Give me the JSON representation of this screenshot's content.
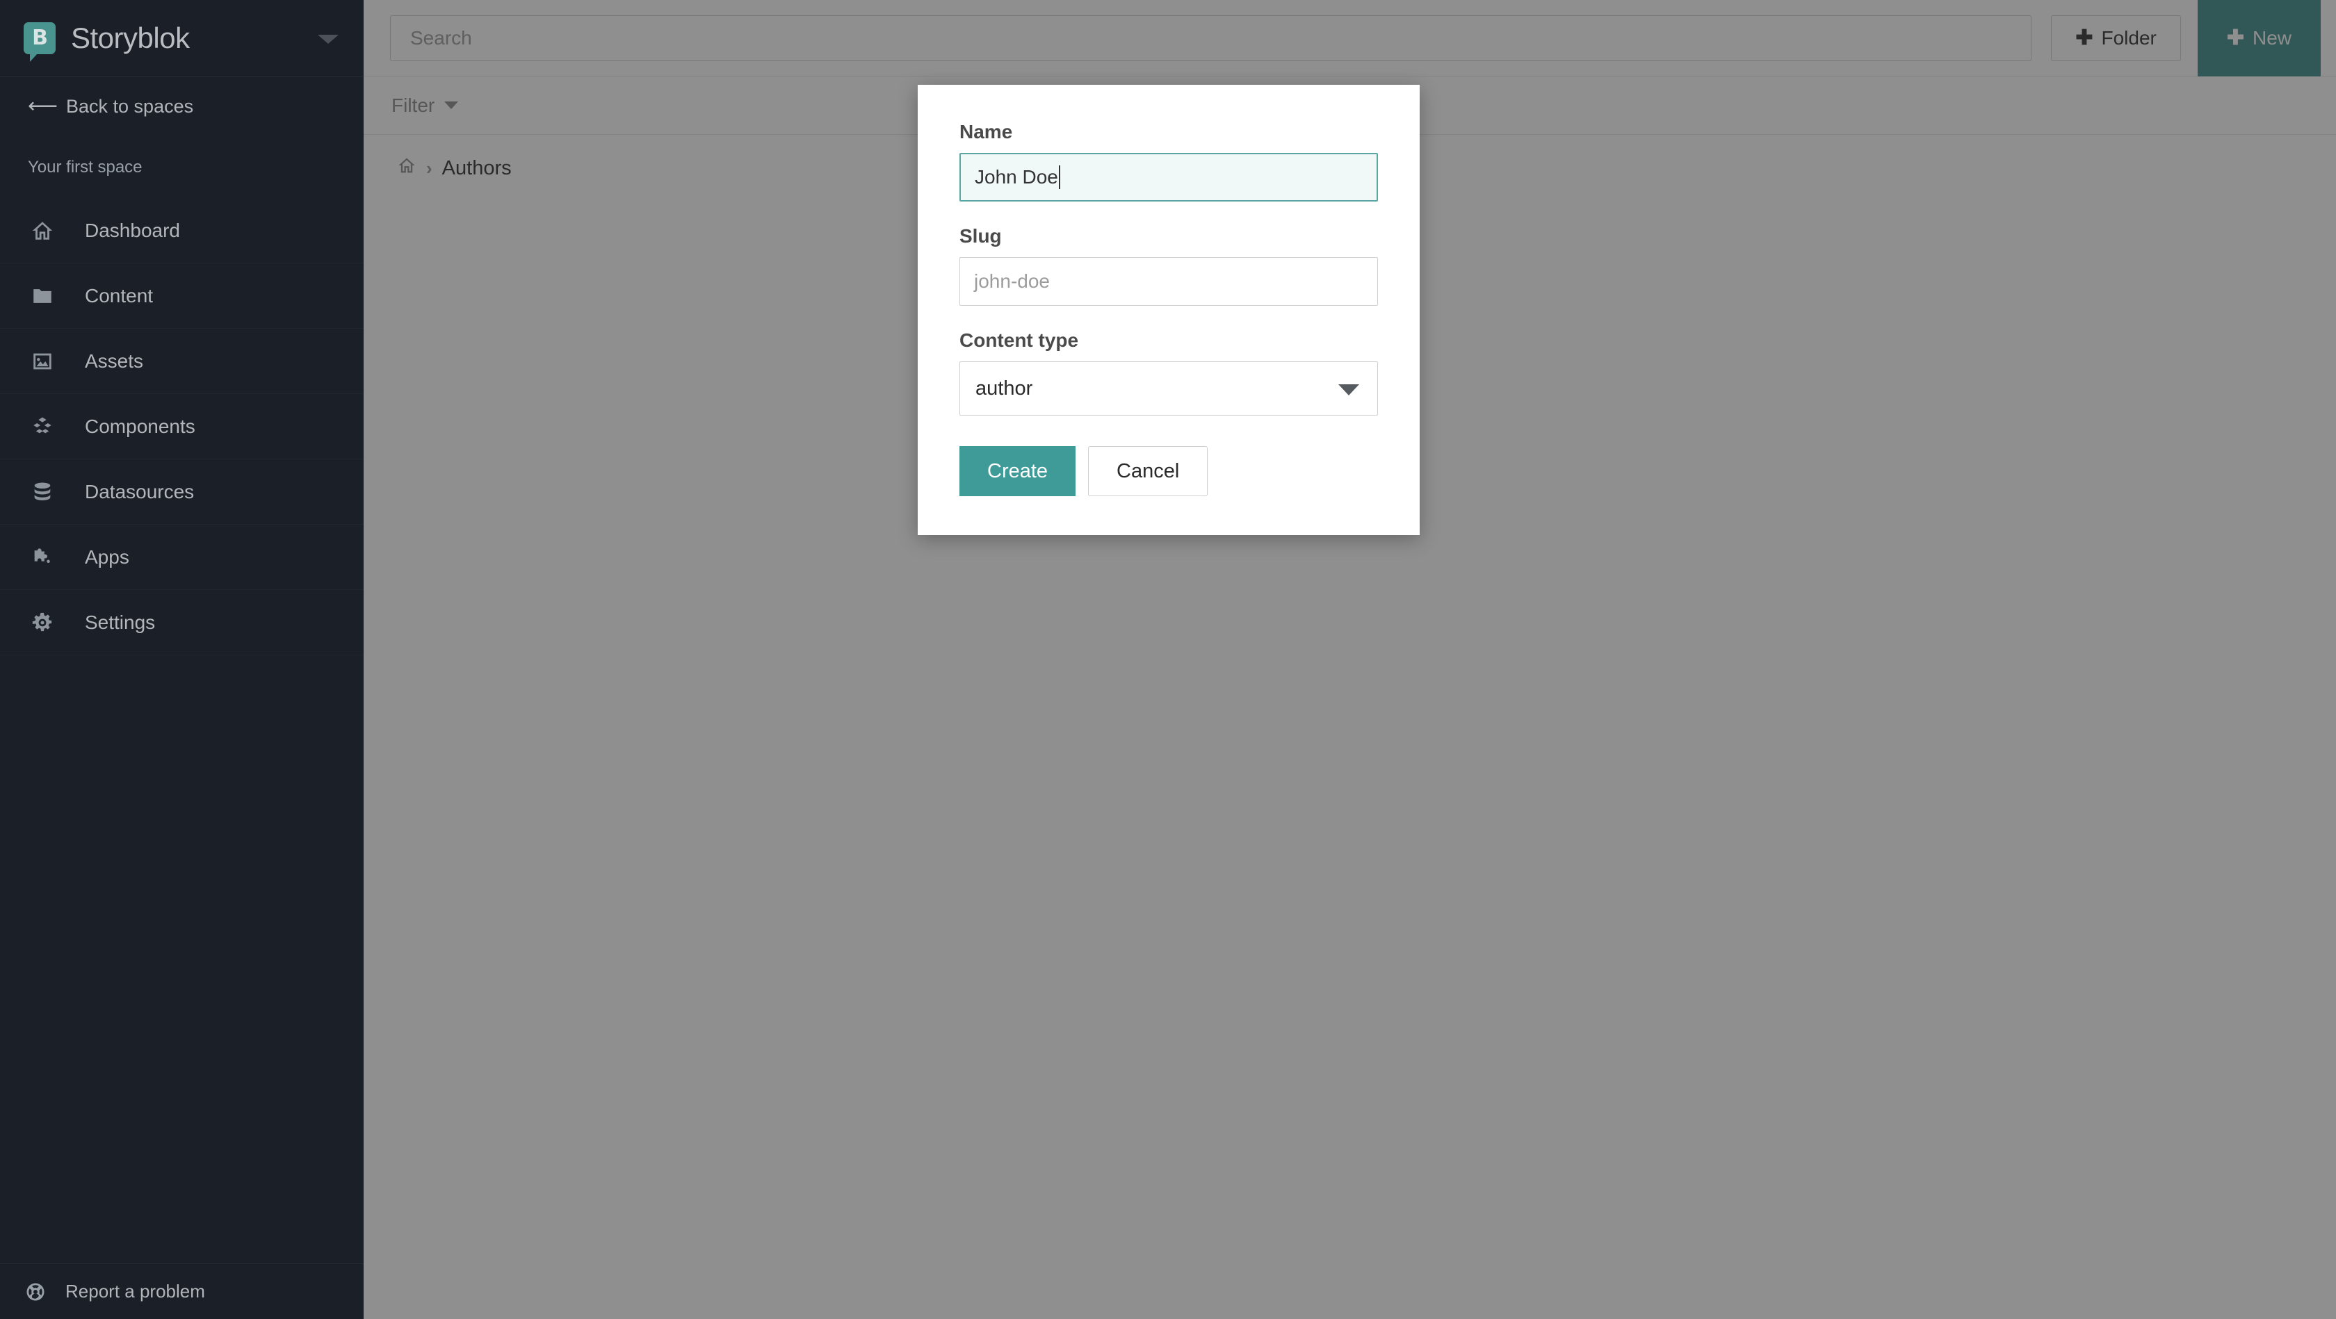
{
  "sidebar": {
    "brand": "Storyblok",
    "brand_mark_letter": "B",
    "space_dropdown_icon": "chevron-down-icon",
    "back_link": "Back to spaces",
    "back_arrow": "⟵",
    "space_name": "Your first space",
    "items": [
      {
        "label": "Dashboard",
        "icon": "home-icon"
      },
      {
        "label": "Content",
        "icon": "folder-icon"
      },
      {
        "label": "Assets",
        "icon": "image-icon"
      },
      {
        "label": "Components",
        "icon": "cubes-icon"
      },
      {
        "label": "Datasources",
        "icon": "database-icon"
      },
      {
        "label": "Apps",
        "icon": "puzzle-icon"
      },
      {
        "label": "Settings",
        "icon": "gear-icon"
      }
    ],
    "footer": {
      "label": "Report a problem",
      "icon": "lifebuoy-icon"
    }
  },
  "topbar": {
    "search_placeholder": "Search",
    "folder_button": "Folder",
    "new_button": "New",
    "plus_glyph": "✚"
  },
  "filterbar": {
    "label": "Filter"
  },
  "breadcrumb": {
    "home_icon": "home-icon",
    "separator": "›",
    "current": "Authors"
  },
  "modal": {
    "name_label": "Name",
    "name_value": "John Doe",
    "slug_label": "Slug",
    "slug_placeholder": "john-doe",
    "content_type_label": "Content type",
    "content_type_value": "author",
    "create_button": "Create",
    "cancel_button": "Cancel"
  },
  "colors": {
    "sidebar_bg": "#1b2028",
    "brand_teal": "#4a9490",
    "accent_teal": "#3f9b97",
    "new_button_teal": "#3c8c88",
    "focus_border": "#5aa6a2",
    "focus_bg": "#f1f8f8",
    "overlay": "#7c7c7d"
  }
}
